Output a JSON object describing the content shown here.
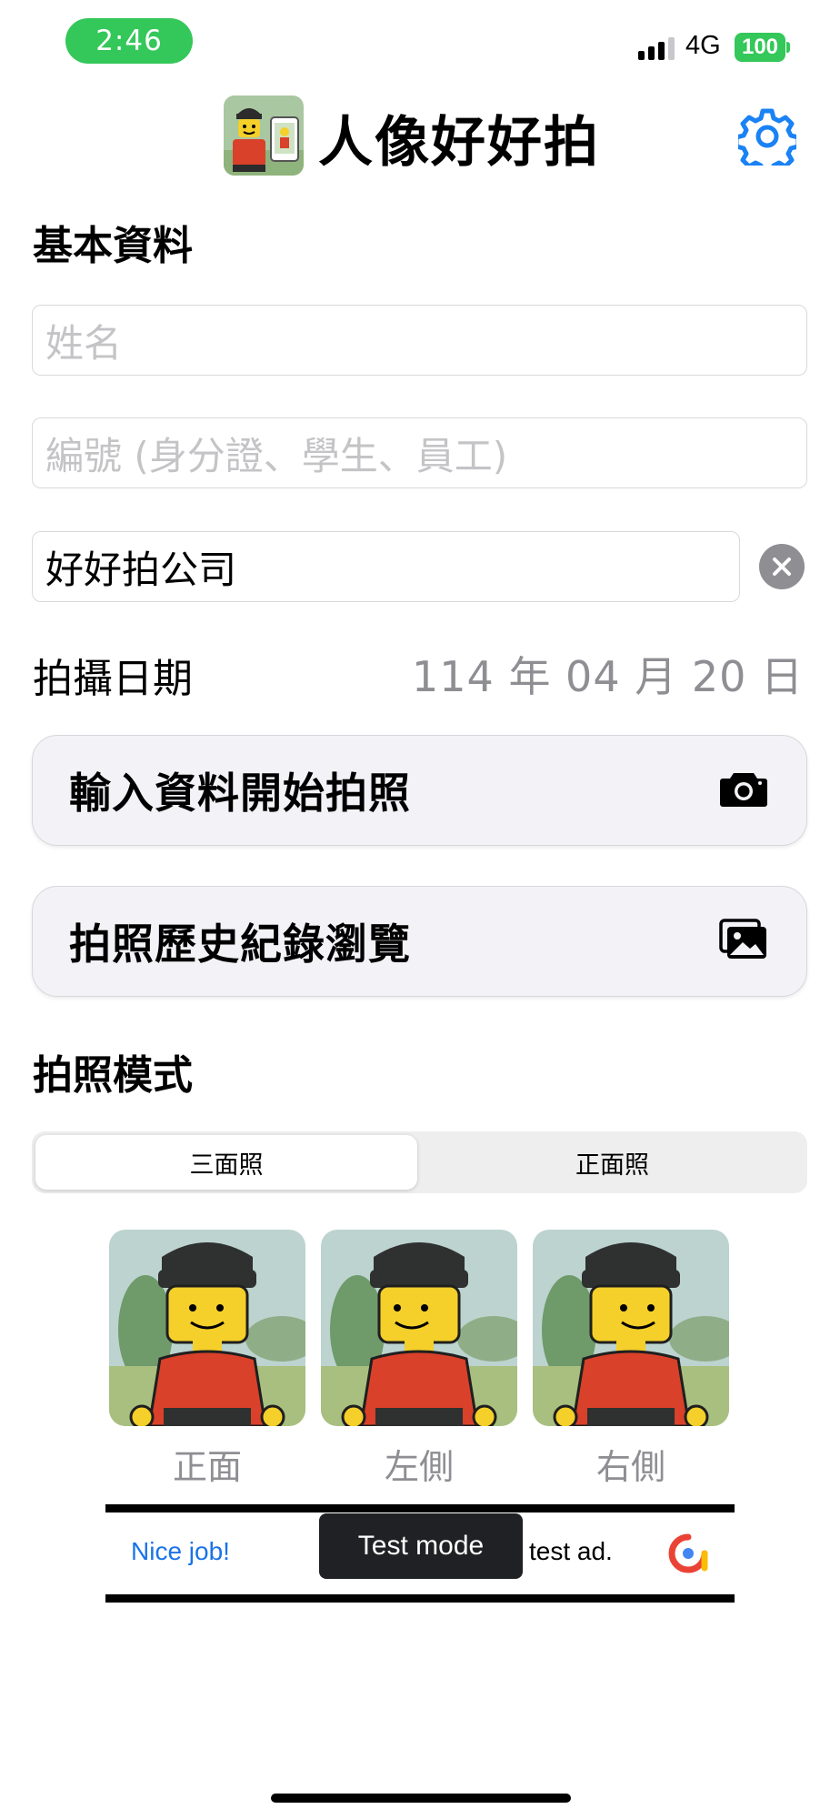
{
  "status_bar": {
    "time": "2:46",
    "network": "4G",
    "battery": "100"
  },
  "header": {
    "title": "人像好好拍",
    "logo": "lego-portrait-logo",
    "settings_icon": "gear-icon"
  },
  "basic_info": {
    "section_title": "基本資料",
    "name_placeholder": "姓名",
    "id_placeholder": "編號 (身分證、學生、員工)",
    "company_value": "好好拍公司",
    "date_label": "拍攝日期",
    "date_value": "114 年 04 月 20 日"
  },
  "actions": {
    "start_label": "輸入資料開始拍照",
    "start_icon": "camera-icon",
    "history_label": "拍照歷史紀錄瀏覽",
    "history_icon": "photo-gallery-icon"
  },
  "mode": {
    "section_title": "拍照模式",
    "options": [
      "三面照",
      "正面照"
    ],
    "selected": "三面照"
  },
  "samples": [
    {
      "label": "正面"
    },
    {
      "label": "左側"
    },
    {
      "label": "右側"
    }
  ],
  "ad": {
    "left_text": "Nice job!",
    "right_text": "test ad.",
    "toast": "Test mode"
  },
  "colors": {
    "accent": "#1a82f5",
    "status_green": "#34c759",
    "secondary_text": "#8e8e93",
    "figure_red": "#d9412a",
    "figure_yellow": "#f5cf2a"
  }
}
